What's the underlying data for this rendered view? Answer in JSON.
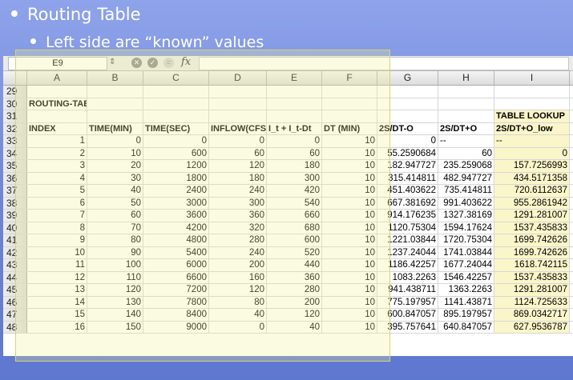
{
  "slide": {
    "bullet1": "Routing Table",
    "bullet2": "Left side are “known” values"
  },
  "formula_bar": {
    "name_box": "E9",
    "fx_label": "fx",
    "cancel_icon": "cancel-icon",
    "confirm_icon": "check-icon"
  },
  "spreadsheet": {
    "columns": [
      "A",
      "B",
      "C",
      "D",
      "E",
      "F",
      "G",
      "H",
      "I"
    ],
    "rows": [
      {
        "num": "29",
        "cells": [
          "",
          "",
          "",
          "",
          "",
          "",
          "",
          "",
          ""
        ]
      },
      {
        "num": "30",
        "cells": [
          "ROUTING-TABLE",
          "",
          "",
          "",
          "",
          "",
          "",
          "",
          ""
        ]
      },
      {
        "num": "31",
        "cells": [
          "",
          "",
          "",
          "",
          "",
          "",
          "",
          "",
          "TABLE LOOKUP"
        ]
      },
      {
        "num": "32",
        "cells": [
          "INDEX",
          "TIME(MIN)",
          "TIME(SEC)",
          "INFLOW(CFS",
          "I_t + I_t-Dt",
          "DT (MIN)",
          "2S/DT-O",
          "2S/DT+O",
          "2S/DT+O_low"
        ]
      },
      {
        "num": "33",
        "cells": [
          "1",
          "0",
          "0",
          "0",
          "0",
          "10",
          "0",
          "--",
          "--"
        ]
      },
      {
        "num": "34",
        "cells": [
          "2",
          "10",
          "600",
          "60",
          "60",
          "10",
          "55.2590684",
          "60",
          "0"
        ]
      },
      {
        "num": "35",
        "cells": [
          "3",
          "20",
          "1200",
          "120",
          "180",
          "10",
          "182.947727",
          "235.259068",
          "157.7256993"
        ]
      },
      {
        "num": "36",
        "cells": [
          "4",
          "30",
          "1800",
          "180",
          "300",
          "10",
          "315.414811",
          "482.947727",
          "434.5171358"
        ]
      },
      {
        "num": "37",
        "cells": [
          "5",
          "40",
          "2400",
          "240",
          "420",
          "10",
          "451.403622",
          "735.414811",
          "720.6112637"
        ]
      },
      {
        "num": "38",
        "cells": [
          "6",
          "50",
          "3000",
          "300",
          "540",
          "10",
          "667.381692",
          "991.403622",
          "955.2861942"
        ]
      },
      {
        "num": "39",
        "cells": [
          "7",
          "60",
          "3600",
          "360",
          "660",
          "10",
          "914.176235",
          "1327.38169",
          "1291.281007"
        ]
      },
      {
        "num": "40",
        "cells": [
          "8",
          "70",
          "4200",
          "320",
          "680",
          "10",
          "1120.75304",
          "1594.17624",
          "1537.435833"
        ]
      },
      {
        "num": "41",
        "cells": [
          "9",
          "80",
          "4800",
          "280",
          "600",
          "10",
          "1221.03844",
          "1720.75304",
          "1699.742626"
        ]
      },
      {
        "num": "42",
        "cells": [
          "10",
          "90",
          "5400",
          "240",
          "520",
          "10",
          "1237.24044",
          "1741.03844",
          "1699.742626"
        ]
      },
      {
        "num": "43",
        "cells": [
          "11",
          "100",
          "6000",
          "200",
          "440",
          "10",
          "1186.42257",
          "1677.24044",
          "1618.742115"
        ]
      },
      {
        "num": "44",
        "cells": [
          "12",
          "110",
          "6600",
          "160",
          "360",
          "10",
          "1083.2263",
          "1546.42257",
          "1537.435833"
        ]
      },
      {
        "num": "45",
        "cells": [
          "13",
          "120",
          "7200",
          "120",
          "280",
          "10",
          "941.438711",
          "1363.2263",
          "1291.281007"
        ]
      },
      {
        "num": "46",
        "cells": [
          "14",
          "130",
          "7800",
          "80",
          "200",
          "10",
          "775.197957",
          "1141.43871",
          "1124.725633"
        ]
      },
      {
        "num": "47",
        "cells": [
          "15",
          "140",
          "8400",
          "40",
          "120",
          "10",
          "600.847057",
          "895.197957",
          "869.0342717"
        ]
      },
      {
        "num": "48",
        "cells": [
          "16",
          "150",
          "9000",
          "0",
          "40",
          "10",
          "395.757641",
          "640.847057",
          "627.9536787"
        ]
      }
    ]
  },
  "colors": {
    "slide_bg": "#6f86d6",
    "selection_overlay": "#f0f096",
    "lookup_fill": "#fbf6c9"
  }
}
